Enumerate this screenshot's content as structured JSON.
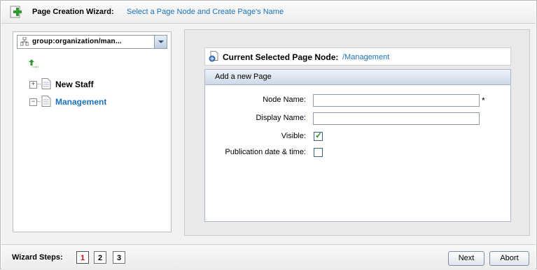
{
  "header": {
    "title": "Page Creation Wizard:",
    "subtitle": "Select a Page Node and Create Page's Name",
    "icon": "page-add-icon"
  },
  "navigation": {
    "selected": "group:organization/man...",
    "up_icon": "up-level-icon",
    "tree": [
      {
        "label": "New Staff",
        "expander": "+",
        "selected": false
      },
      {
        "label": "Management",
        "expander": "−",
        "selected": true
      }
    ]
  },
  "current_node": {
    "label": "Current Selected Page Node:",
    "path": "/Management"
  },
  "form": {
    "header": "Add a new Page",
    "node_name_label": "Node Name:",
    "node_name_value": "",
    "required_mark": "*",
    "display_name_label": "Display Name:",
    "display_name_value": "",
    "visible_label": "Visible:",
    "visible_checked": true,
    "publication_label": "Publication date & time:",
    "publication_checked": false
  },
  "footer": {
    "steps_label": "Wizard Steps:",
    "steps": [
      "1",
      "2",
      "3"
    ],
    "active_step": "1",
    "next_label": "Next",
    "abort_label": "Abort"
  },
  "colors": {
    "link_blue": "#1a72b8",
    "active_step_red": "#d00000",
    "checkmark_green": "#2a8a2a"
  }
}
